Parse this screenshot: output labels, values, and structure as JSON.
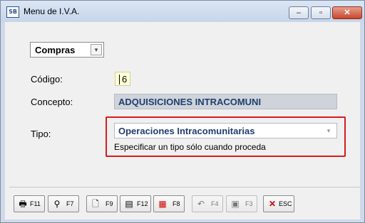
{
  "window": {
    "app_icon_text": "SB",
    "title": "Menu de I.V.A.",
    "minimize_label": "‒",
    "maximize_label": "▫",
    "close_label": "✕"
  },
  "form": {
    "mode_combo": {
      "value": "Compras",
      "arrow": "▾"
    },
    "codigo_label": "Código:",
    "codigo_value": "6",
    "concepto_label": "Concepto:",
    "concepto_value": "ADQUISICIONES INTRACOMUNI",
    "tipo_label": "Tipo:",
    "tipo_value": "Operaciones Intracomunitarias",
    "tipo_arrow": "▾",
    "tipo_hint": "Especificar un tipo sólo cuando proceda"
  },
  "toolbar": [
    {
      "key": "F11",
      "icon": "printer-icon",
      "glyph": "🖶",
      "disabled": false
    },
    {
      "key": "F7",
      "icon": "binoculars-icon",
      "glyph": "⚲",
      "disabled": false
    },
    {
      "key": "F9",
      "icon": "new-document-icon",
      "glyph": "🗋",
      "disabled": false
    },
    {
      "key": "F12",
      "icon": "edit-list-icon",
      "glyph": "▤",
      "disabled": false
    },
    {
      "key": "F8",
      "icon": "delete-icon",
      "glyph": "▦",
      "disabled": false
    },
    {
      "key": "F4",
      "icon": "undo-icon",
      "glyph": "↶",
      "disabled": true
    },
    {
      "key": "F3",
      "icon": "save-icon",
      "glyph": "▣",
      "disabled": true
    },
    {
      "key": "ESC",
      "icon": "cancel-icon",
      "glyph": "✕",
      "disabled": false
    }
  ]
}
